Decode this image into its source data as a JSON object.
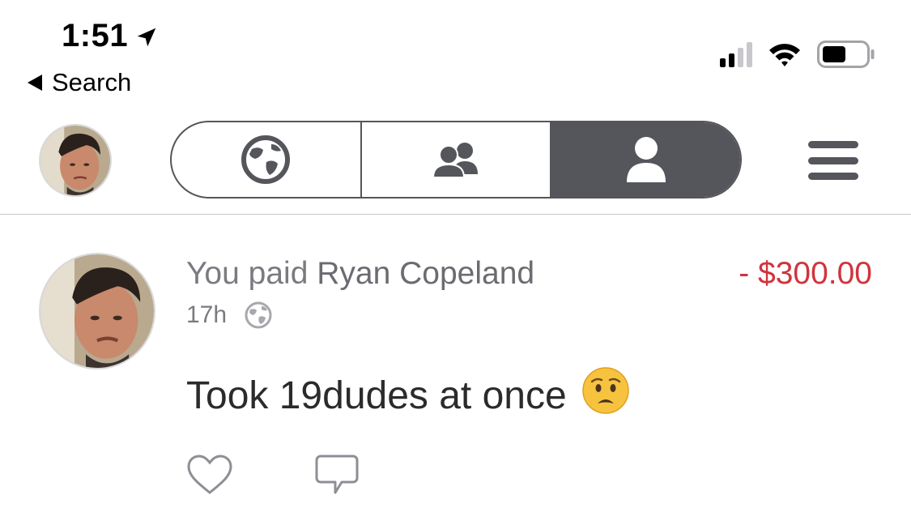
{
  "status_bar": {
    "time": "1:51",
    "back_label": "Search",
    "icons": [
      "location-arrow-icon",
      "cellular-signal-icon",
      "wifi-icon",
      "battery-icon"
    ],
    "signal_bars_active": 2,
    "signal_bars_total": 4,
    "battery_level": 0.5
  },
  "nav": {
    "segments": [
      {
        "id": "public",
        "icon": "globe-icon",
        "active": false
      },
      {
        "id": "friends",
        "icon": "friends-icon",
        "active": false
      },
      {
        "id": "mine",
        "icon": "person-icon",
        "active": true
      }
    ],
    "menu_icon": "hamburger-menu-icon"
  },
  "feed": {
    "items": [
      {
        "headline_prefix": "You paid ",
        "recipient": "Ryan Copeland",
        "amount": "- $300.00",
        "time_ago": "17h",
        "visibility_icon": "globe-icon",
        "note": "Took 19dudes at once",
        "emoji": "😧",
        "actions": [
          "heart-icon",
          "comment-icon"
        ]
      }
    ]
  },
  "colors": {
    "accent_gray": "#55565b",
    "amount_red": "#d0343d",
    "secondary_text": "#7a7b80",
    "divider": "#c8c8cc"
  }
}
